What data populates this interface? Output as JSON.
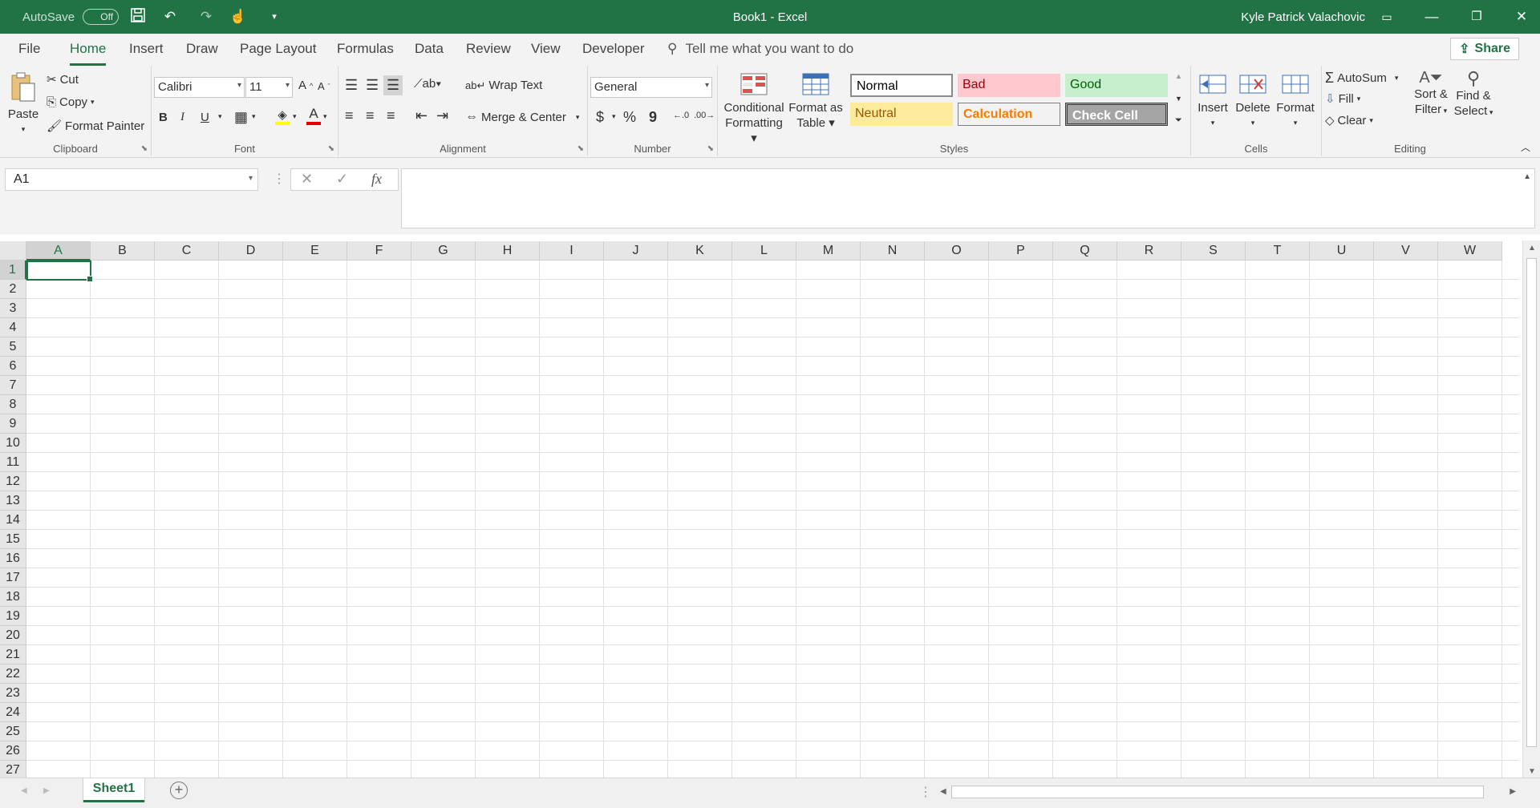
{
  "titlebar": {
    "autosave_label": "AutoSave",
    "autosave_state": "Off",
    "title": "Book1  -  Excel",
    "user": "Kyle Patrick Valachovic"
  },
  "tabs": [
    "File",
    "Home",
    "Insert",
    "Draw",
    "Page Layout",
    "Formulas",
    "Data",
    "Review",
    "View",
    "Developer"
  ],
  "active_tab": "Home",
  "tell_me": "Tell me what you want to do",
  "share": "Share",
  "clipboard": {
    "paste": "Paste",
    "cut": "Cut",
    "copy": "Copy",
    "format_painter": "Format Painter",
    "label": "Clipboard"
  },
  "font": {
    "name": "Calibri",
    "size": "11",
    "label": "Font",
    "bold": "B",
    "italic": "I",
    "underline": "U"
  },
  "alignment": {
    "wrap": "Wrap Text",
    "merge": "Merge & Center",
    "label": "Alignment"
  },
  "number": {
    "format": "General",
    "label": "Number",
    "currency": "$",
    "percent": "%",
    "comma": "9"
  },
  "styles": {
    "conditional_1": "Conditional",
    "conditional_2": "Formatting",
    "format_table_1": "Format as",
    "format_table_2": "Table",
    "label": "Styles",
    "items": [
      {
        "name": "Normal",
        "color": "#000000",
        "bg": "#ffffff"
      },
      {
        "name": "Bad",
        "color": "#9c0006",
        "bg": "#ffc7ce"
      },
      {
        "name": "Good",
        "color": "#006100",
        "bg": "#c6efce"
      },
      {
        "name": "Neutral",
        "color": "#9c5700",
        "bg": "#ffeb9c"
      },
      {
        "name": "Calculation",
        "color": "#fa7d00",
        "bg": "#f2f2f2"
      },
      {
        "name": "Check Cell",
        "color": "#ffffff",
        "bg": "#a5a5a5"
      }
    ]
  },
  "cells_group": {
    "insert": "Insert",
    "delete": "Delete",
    "format": "Format",
    "label": "Cells"
  },
  "editing": {
    "autosum": "AutoSum",
    "fill": "Fill",
    "clear": "Clear",
    "sort_1": "Sort &",
    "sort_2": "Filter",
    "find_1": "Find &",
    "find_2": "Select",
    "label": "Editing"
  },
  "formula_bar": {
    "name_box": "A1",
    "fx": "fx",
    "value": ""
  },
  "columns": [
    "A",
    "B",
    "C",
    "D",
    "E",
    "F",
    "G",
    "H",
    "I",
    "J",
    "K",
    "L",
    "M",
    "N",
    "O",
    "P",
    "Q",
    "R",
    "S",
    "T",
    "U",
    "V",
    "W"
  ],
  "rows": [
    "1",
    "2",
    "3",
    "4",
    "5",
    "6",
    "7",
    "8",
    "9",
    "10",
    "11",
    "12",
    "13",
    "14",
    "15",
    "16",
    "17",
    "18",
    "19",
    "20",
    "21",
    "22",
    "23",
    "24",
    "25",
    "26",
    "27"
  ],
  "selected_cell": "A1",
  "sheets": [
    "Sheet1"
  ],
  "colors": {
    "accent": "#217346"
  }
}
